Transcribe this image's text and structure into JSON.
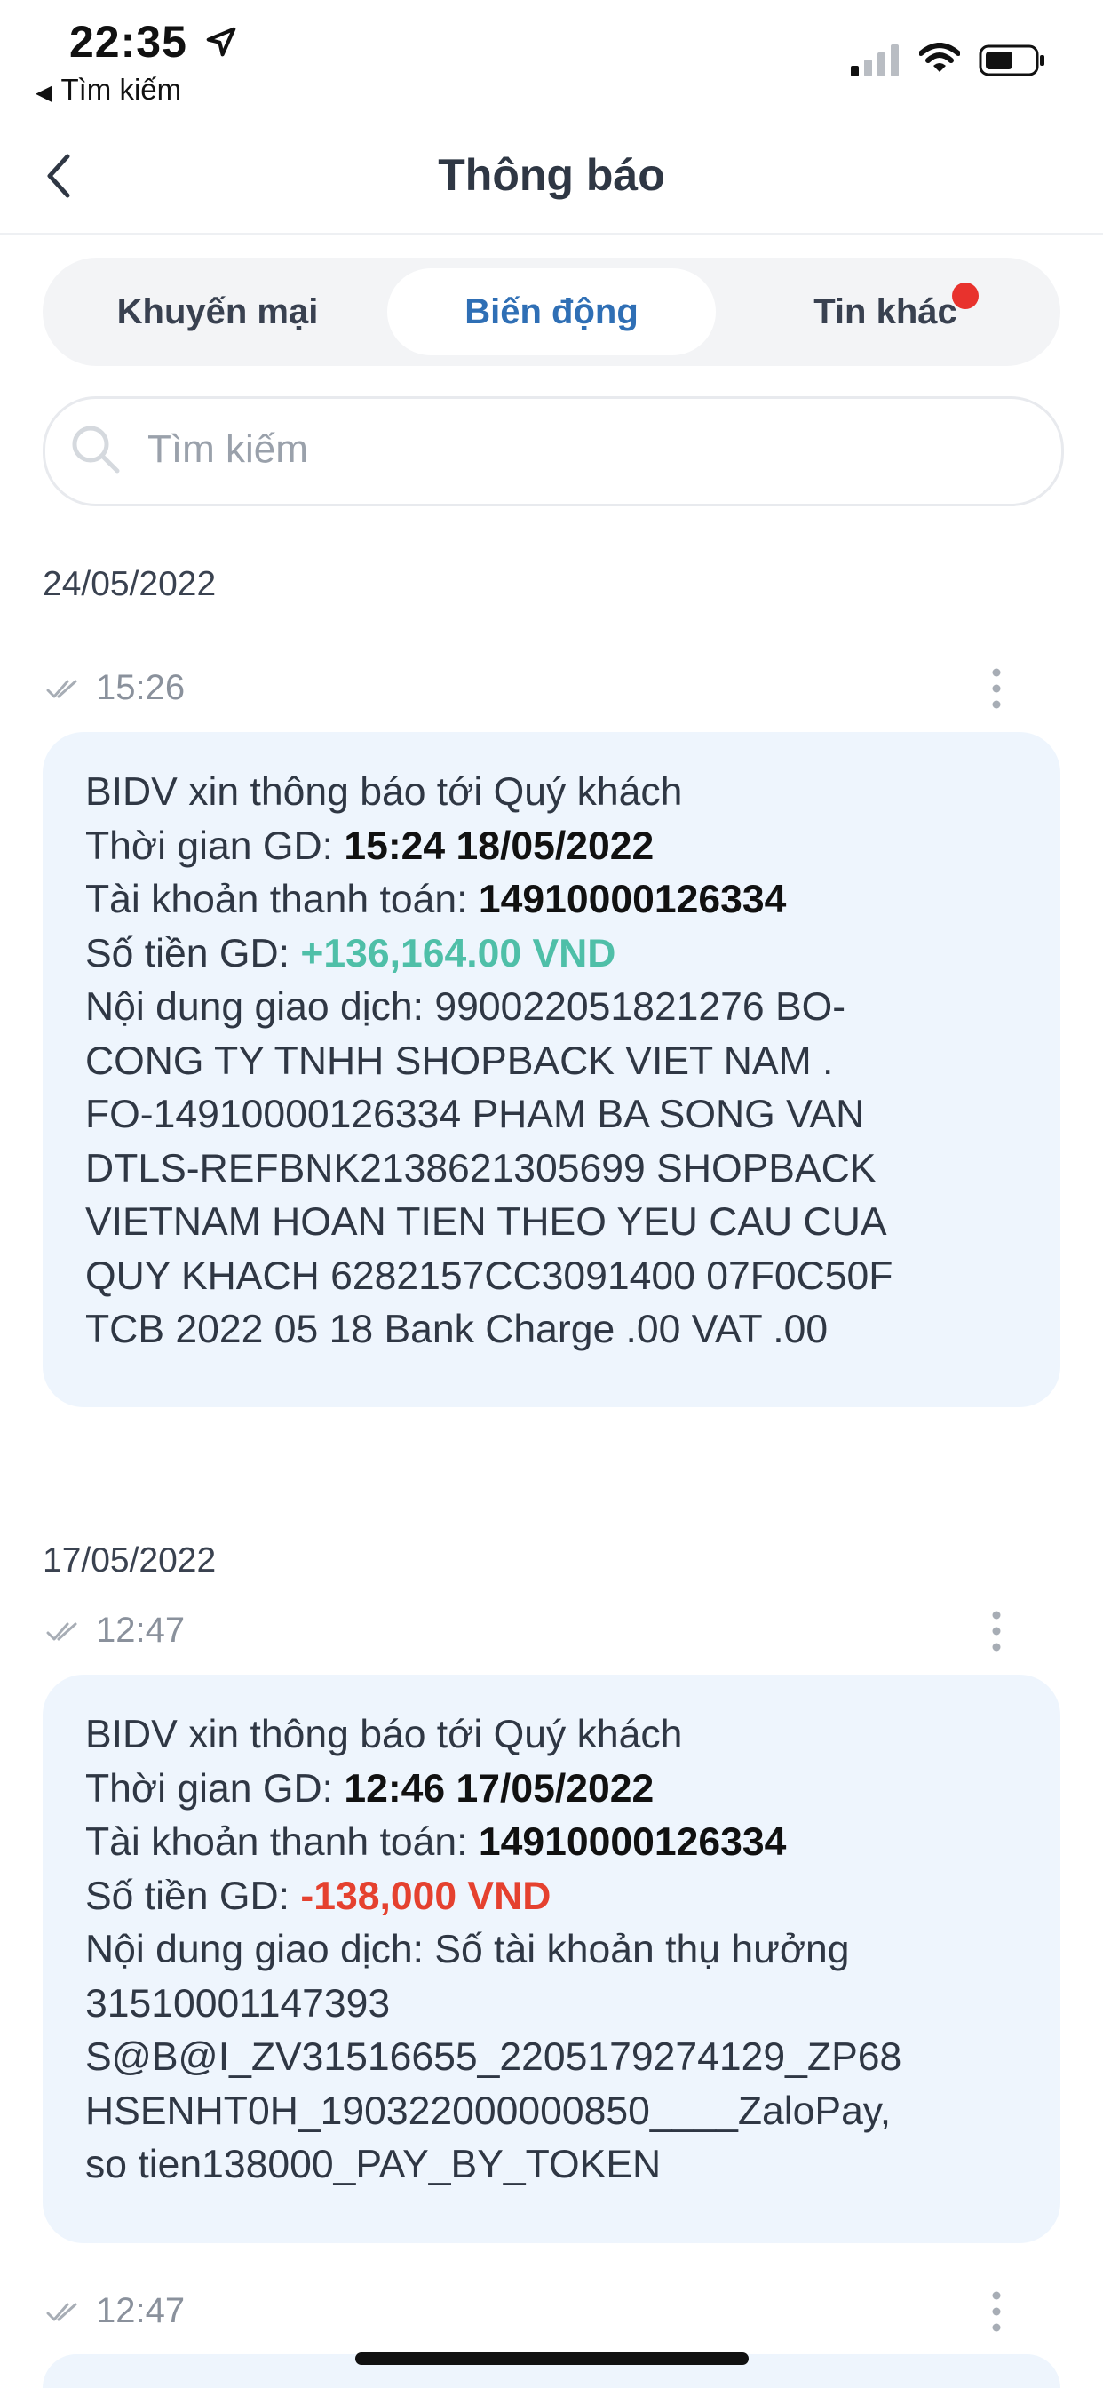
{
  "status_bar": {
    "time": "22:35",
    "back_app": "Tìm kiếm"
  },
  "header": {
    "title": "Thông báo"
  },
  "tabs": [
    {
      "label": "Khuyến mại",
      "selected": false,
      "badge": false
    },
    {
      "label": "Biến động",
      "selected": true,
      "badge": false
    },
    {
      "label": "Tin khác",
      "selected": false,
      "badge": true
    }
  ],
  "search": {
    "placeholder": "Tìm kiếm",
    "value": ""
  },
  "colors": {
    "accent": "#2f6fb5",
    "positive": "#4fbfa8",
    "negative": "#e5412f",
    "badge": "#e8322d",
    "card_bg": "#eef5fd"
  },
  "groups": [
    {
      "date": "24/05/2022",
      "messages": [
        {
          "time": "15:26",
          "greeting": "BIDV xin thông báo tới Quý khách",
          "time_label": "Thời gian GD: ",
          "time_value": "15:24 18/05/2022",
          "account_label": "Tài khoản thanh toán: ",
          "account_value": "14910000126334",
          "amount_label": "Số tiền GD: ",
          "amount_value": "+136,164.00 VND",
          "content_lines": [
            "Nội dung giao dịch: 990022051821276 BO-",
            "CONG TY TNHH SHOPBACK VIET NAM .",
            "FO-14910000126334 PHAM BA SONG VAN",
            "DTLS-REFBNK2138621305699 SHOPBACK",
            "VIETNAM HOAN TIEN THEO YEU CAU CUA",
            "QUY KHACH 6282157CC3091400 07F0C50F",
            "TCB 2022 05 18 Bank Charge .00 VAT .00"
          ]
        }
      ]
    },
    {
      "date": "17/05/2022",
      "messages": [
        {
          "time": "12:47",
          "greeting": "BIDV xin thông báo tới Quý khách",
          "time_label": "Thời gian GD: ",
          "time_value": "12:46 17/05/2022",
          "account_label": "Tài khoản thanh toán: ",
          "account_value": "14910000126334",
          "amount_label": "Số tiền GD: ",
          "amount_value": "-138,000 VND",
          "content_lines": [
            "Nội dung giao dịch: Số tài khoản thụ hưởng",
            "31510001147393",
            "S@B@I_ZV31516655_2205179274129_ZP68",
            "HSENHT0H_190322000000850____ZaloPay,",
            "so tien138000_PAY_BY_TOKEN"
          ]
        },
        {
          "time": "12:47"
        }
      ]
    }
  ]
}
